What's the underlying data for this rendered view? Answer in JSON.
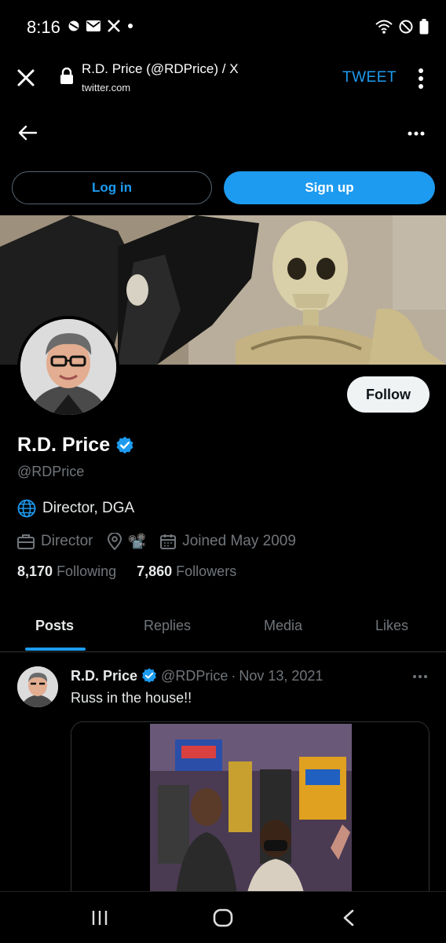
{
  "status_bar": {
    "time": "8:16",
    "left_icons": [
      "notification-icon",
      "mail-icon",
      "tools-icon",
      "dot-icon"
    ],
    "right_icons": [
      "wifi-icon",
      "do-not-disturb-icon",
      "battery-icon"
    ]
  },
  "browser": {
    "page_title": "R.D. Price (@RDPrice) / X",
    "url": "twitter.com",
    "action_label": "TWEET"
  },
  "auth": {
    "login_label": "Log in",
    "signup_label": "Sign up"
  },
  "profile": {
    "display_name": "R.D. Price",
    "verified": true,
    "handle": "@RDPrice",
    "follow_label": "Follow",
    "bio": "Director, DGA",
    "profession": "Director",
    "location": "📽️",
    "joined": "Joined May 2009",
    "following_count": "8,170",
    "following_label": "Following",
    "followers_count": "7,860",
    "followers_label": "Followers"
  },
  "tabs": [
    {
      "label": "Posts",
      "active": true
    },
    {
      "label": "Replies",
      "active": false
    },
    {
      "label": "Media",
      "active": false
    },
    {
      "label": "Likes",
      "active": false
    }
  ],
  "post": {
    "author_name": "R.D. Price",
    "author_handle": "@RDPrice",
    "separator": "·",
    "date": "Nov 13, 2021",
    "text": "Russ in the house!!"
  },
  "colors": {
    "accent": "#1d9bf0",
    "background": "#000000",
    "text_secondary": "#71767b"
  }
}
